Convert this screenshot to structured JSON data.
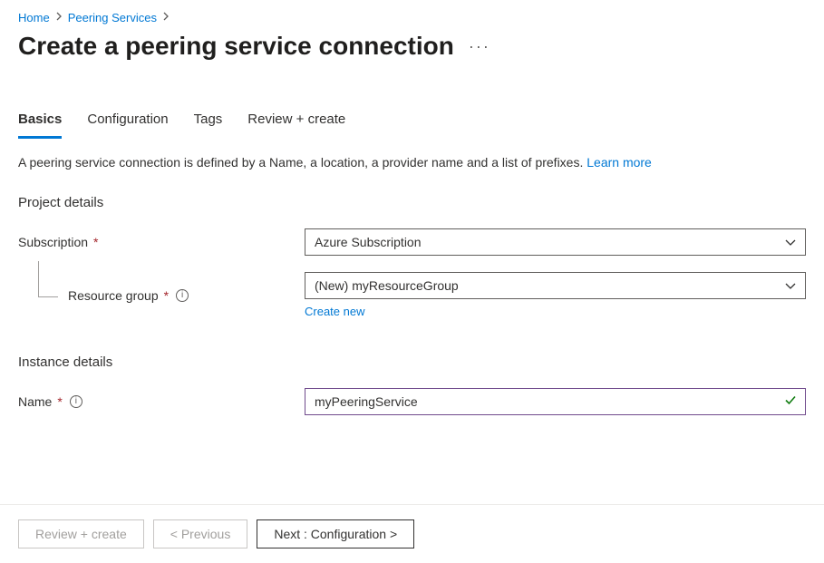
{
  "breadcrumb": {
    "items": [
      "Home",
      "Peering Services"
    ]
  },
  "page": {
    "title": "Create a peering service connection"
  },
  "tabs": {
    "items": [
      "Basics",
      "Configuration",
      "Tags",
      "Review + create"
    ],
    "active_index": 0
  },
  "description": {
    "text": "A peering service connection is defined by a Name, a location, a provider name and a list of prefixes. ",
    "learn_more": "Learn more"
  },
  "sections": {
    "project": {
      "header": "Project details",
      "subscription_label": "Subscription",
      "subscription_value": "Azure Subscription",
      "resource_group_label": "Resource group",
      "resource_group_value": "(New) myResourceGroup",
      "create_new": "Create new"
    },
    "instance": {
      "header": "Instance details",
      "name_label": "Name",
      "name_value": "myPeeringService"
    }
  },
  "footer": {
    "review": "Review + create",
    "previous": "< Previous",
    "next": "Next : Configuration >"
  }
}
